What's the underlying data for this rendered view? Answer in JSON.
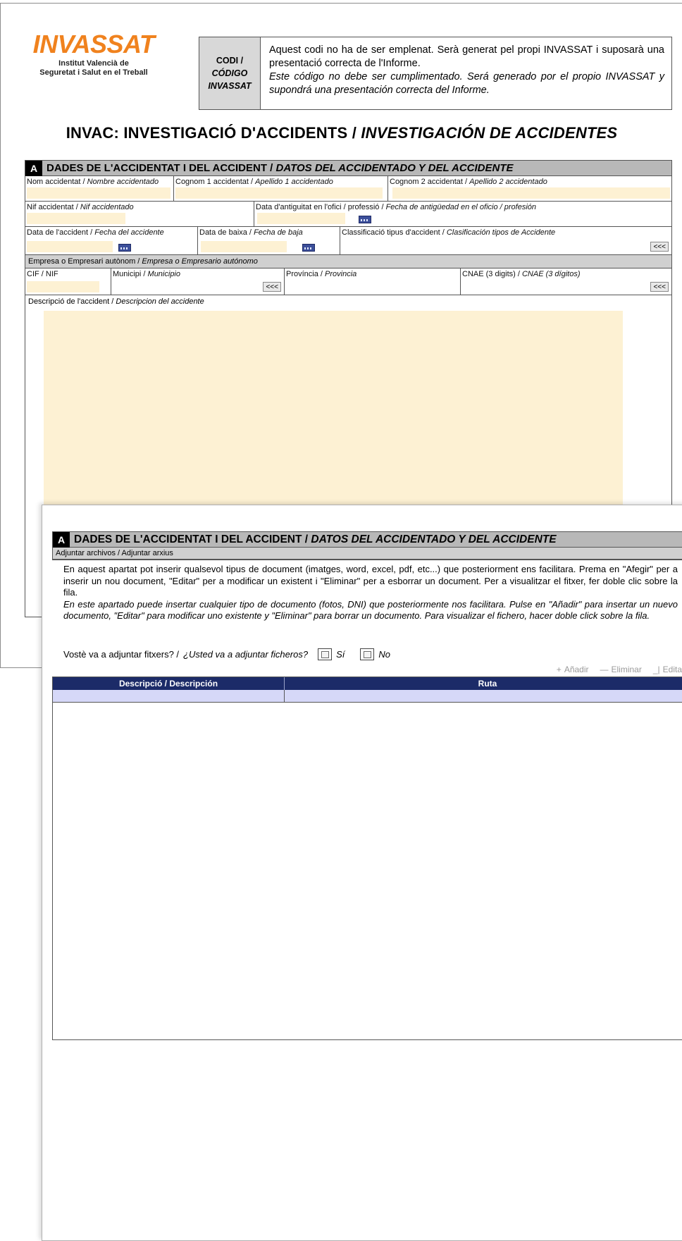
{
  "logo": {
    "word": "INVASSAT",
    "sub1": "Institut Valencià de",
    "sub2": "Seguretat i Salut en el Treball"
  },
  "code_box": {
    "label1": "CODI /",
    "label2": "CÓDIGO",
    "label3": "INVASSAT",
    "text_ca": "Aquest codi no ha de ser emplenat. Serà generat pel propi INVASSAT i suposarà una presentació correcta de l'Informe.",
    "text_es": "Este código no debe ser cumplimentado. Será generado por el propio INVASSAT y supondrá una presentación correcta del Informe."
  },
  "title": {
    "ca": "INVAC: INVESTIGACIÓ D'ACCIDENTS / ",
    "es": "INVESTIGACIÓN DE ACCIDENTES"
  },
  "section_a": {
    "letter": "A",
    "title_ca": "DADES DE L'ACCIDENTAT I DEL ACCIDENT / ",
    "title_es": "DATOS DEL ACCIDENTADO Y DEL ACCIDENTE",
    "fields": {
      "nom_ca": "Nom accidentat / ",
      "nom_es": "Nombre accidentado",
      "cognom1_ca": "Cognom 1 accidentat / ",
      "cognom1_es": "Apellido 1 accidentado",
      "cognom2_ca": "Cognom 2 accidentat / ",
      "cognom2_es": "Apellido 2 accidentado",
      "nif_ca": "Nif accidentat / ",
      "nif_es": "Nif accidentado",
      "antiguitat_ca": "Data d'antiguitat en l'ofici / professió / ",
      "antiguitat_es": "Fecha de antigüedad en el oficio / profesión",
      "data_accident_ca": "Data de l'accident / ",
      "data_accident_es": "Fecha del accidente",
      "data_baixa_ca": "Data de baixa / ",
      "data_baixa_es": "Fecha de baja",
      "classificacio_ca": "Classificació tipus d'accident / ",
      "classificacio_es": "Clasificación tipos de Accidente",
      "empresa_ca": "Empresa o Empresari autònom / ",
      "empresa_es": "Empresa o Empresario autónomo",
      "cif": "CIF / NIF",
      "municipi_ca": "Municipi / ",
      "municipi_es": "Municipio",
      "provincia_ca": "Província / ",
      "provincia_es": "Provincia",
      "cnae_ca": "CNAE (3 digits) / ",
      "cnae_es": "CNAE (3 dígitos)",
      "descripcio_ca": "Descripció de l'accident / ",
      "descripcio_es": "Descripcion del accidente"
    },
    "arrow_label": "<<<"
  },
  "section_b": {
    "letter": "A",
    "title_ca": "DADES DE L'ACCIDENTAT I DEL ACCIDENT / ",
    "title_es": "DATOS DEL ACCIDENTADO Y DEL ACCIDENTE",
    "attach_label": "Adjuntar archivos / Adjuntar arxius",
    "info_ca": "En aquest apartat pot inserir qualsevol tipus de document (imatges, word, excel, pdf, etc...) que posteriorment ens facilitara. Prema en \"Afegir\" per a inserir un nou document, \"Editar\" per a modificar un existent i \"Eliminar\" per a esborrar un document. Per a visualitzar el fitxer, fer doble clic sobre la fila.",
    "info_es": "En este apartado puede insertar cualquier tipo de documento (fotos, DNI) que posteriormente nos facilitara. Pulse en \"Añadir\" para insertar un nuevo documento, \"Editar\" para modificar uno existente y \"Eliminar\" para borrar un documento. Para visualizar el fichero, hacer doble click sobre la fila.",
    "question_ca": "Vostè va a adjuntar fitxers? / ",
    "question_es": "¿Usted va a adjuntar ficheros?",
    "opt_si": "Sí",
    "opt_no": "No",
    "toolbar": {
      "add": "Añadir",
      "delete": "Eliminar",
      "edit": "Editar"
    },
    "grid": {
      "col1": "Descripció / Descripción",
      "col2": "Ruta"
    }
  }
}
